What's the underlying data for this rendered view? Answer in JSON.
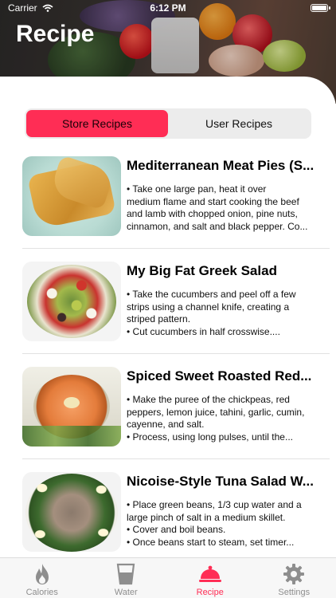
{
  "status_bar": {
    "carrier": "Carrier",
    "time": "6:12 PM"
  },
  "header": {
    "title": "Recipe"
  },
  "segmented": {
    "options": [
      {
        "label": "Store Recipes",
        "selected": true
      },
      {
        "label": "User Recipes",
        "selected": false
      }
    ]
  },
  "recipes": [
    {
      "title": "Mediterranean Meat Pies (S...",
      "lines": [
        "•     Take one large pan, heat it over",
        "medium flame and start cooking the beef",
        "and lamb with chopped onion, pine nuts,",
        "cinnamon, and salt and black pepper. Co..."
      ],
      "image": "meat-pies"
    },
    {
      "title": "My Big Fat Greek Salad",
      "lines": [
        "•     Take the cucumbers and peel off a few",
        "strips using a channel knife, creating a",
        "striped pattern.",
        "•     Cut cucumbers in half crosswise...."
      ],
      "image": "greek-salad"
    },
    {
      "title": "Spiced Sweet Roasted Red...",
      "lines": [
        "•     Make the puree of  the chickpeas, red",
        "peppers, lemon juice, tahini, garlic, cumin,",
        "cayenne, and salt.",
        "•     Process, using long pulses, until the..."
      ],
      "image": "roasted-red-pepper-hummus"
    },
    {
      "title": "Nicoise-Style Tuna Salad W...",
      "lines": [
        "•     Place green beans, 1/3 cup water and a",
        "large pinch of salt in a medium skillet.",
        "•     Cover and boil beans.",
        "•      Once beans start to steam, set timer..."
      ],
      "image": "tuna-salad"
    }
  ],
  "tabbar": {
    "items": [
      {
        "label": "Calories",
        "icon": "flame-icon",
        "active": false
      },
      {
        "label": "Water",
        "icon": "water-glass-icon",
        "active": false
      },
      {
        "label": "Recipe",
        "icon": "food-cloche-icon",
        "active": true
      },
      {
        "label": "Settings",
        "icon": "gear-icon",
        "active": false
      }
    ]
  },
  "colors": {
    "accent": "#ff2d55",
    "inactive_tab": "#8e8e8e",
    "segment_bg": "#ececec"
  }
}
